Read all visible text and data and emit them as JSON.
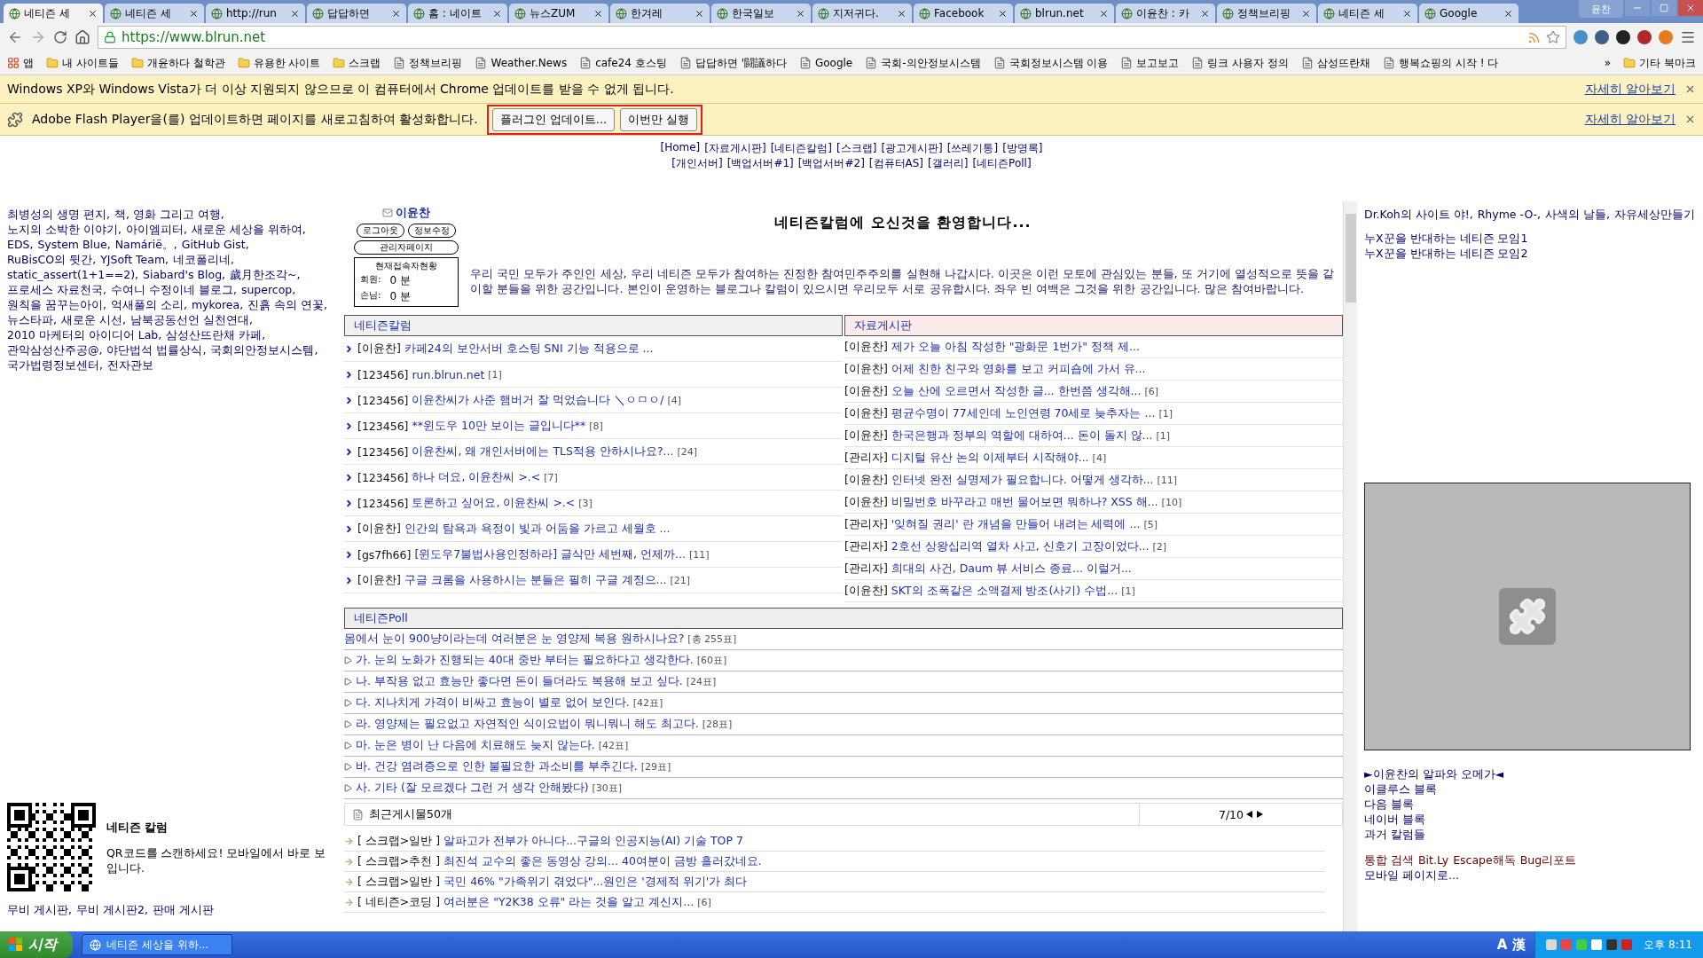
{
  "browser": {
    "tabs": [
      {
        "title": "네티즌 세",
        "selected": true
      },
      {
        "title": "네티즌 세",
        "selected": false
      },
      {
        "title": "http://run",
        "selected": false
      },
      {
        "title": "답답하면",
        "selected": false
      },
      {
        "title": "홈 : 네이트",
        "selected": false
      },
      {
        "title": "뉴스ZUM",
        "selected": false
      },
      {
        "title": "한겨레",
        "selected": false
      },
      {
        "title": "한국일보",
        "selected": false
      },
      {
        "title": "지저귀다.",
        "selected": false
      },
      {
        "title": "Facebook",
        "selected": false
      },
      {
        "title": "blrun.net",
        "selected": false
      },
      {
        "title": "이윤찬 : 카",
        "selected": false
      },
      {
        "title": "정책브리핑",
        "selected": false
      },
      {
        "title": "네티즌 세",
        "selected": false
      },
      {
        "title": "Google",
        "selected": false
      }
    ],
    "profile": "윤찬",
    "url": "https://www.blrun.net",
    "bookmarks": [
      {
        "label": "앱",
        "kind": "apps"
      },
      {
        "label": "내 사이트들",
        "kind": "folder"
      },
      {
        "label": "개윤하다 철학관",
        "kind": "folder"
      },
      {
        "label": "유용한 사이트",
        "kind": "folder"
      },
      {
        "label": "스크랩",
        "kind": "folder"
      },
      {
        "label": "정책브리핑",
        "kind": "page"
      },
      {
        "label": "Weather.News",
        "kind": "page"
      },
      {
        "label": "cafe24 호스팅",
        "kind": "page"
      },
      {
        "label": "답답하면 '闘議하다",
        "kind": "page"
      },
      {
        "label": "Google",
        "kind": "page"
      },
      {
        "label": "국회-의안정보시스템",
        "kind": "page"
      },
      {
        "label": "국회정보시스템 이용",
        "kind": "page"
      },
      {
        "label": "보고보고",
        "kind": "page"
      },
      {
        "label": "링크 사용자 정의",
        "kind": "page"
      },
      {
        "label": "삼성뜨란채",
        "kind": "page"
      },
      {
        "label": "행복쇼핑의 시작 ! 다",
        "kind": "page"
      }
    ],
    "more": "»",
    "other_bookmarks": "기타 북마크"
  },
  "infobars": [
    {
      "kind": "notice",
      "message": "Windows XP와 Windows Vista가 더 이상 지원되지 않으므로 이 컴퓨터에서 Chrome 업데이트를 받을 수 없게 됩니다.",
      "link": "자세히 알아보기"
    },
    {
      "kind": "plugin",
      "message": "Adobe Flash Player을(를) 업데이트하면 페이지를 새로고침하여 활성화합니다.",
      "buttons": [
        "플러그인 업데이트...",
        "이번만 실행"
      ],
      "highlighted": true,
      "link": "자세히 알아보기"
    }
  ],
  "nav": [
    [
      "[Home]",
      "[자료게시판]",
      "[네티즌칼럼]",
      "[스크랩]",
      "[광고게시판]",
      "[쓰레기통]",
      "[방명록]"
    ],
    [
      "[개인서버]",
      "[백업서버#1]",
      "[백업서버#2]",
      "[컴퓨터AS]",
      "[갤러리]",
      "[네티즌Poll]"
    ]
  ],
  "left_column": {
    "links": [
      "최병성의 생명 편지,",
      "책, 영화 그리고 여행,",
      "노지의 소박한 이야기,",
      "아이엠피터,",
      "새로운 세상을 위하여,",
      "EDS,",
      "System Blue,",
      "Namárië。,",
      "GitHub Gist,",
      "RuBisCO의 뒷간,",
      "YJSoft Team,",
      "네코폴리네,",
      "static_assert(1+1==2),",
      "Siabard's Blog,",
      "歲月한조각~,",
      "프로세스 자료천국,",
      "수여니 수정이네 블로그,",
      "supercop,",
      "원칙을 꿈꾸는아이,",
      "억새풀의 소리,",
      "mykorea,",
      "진흙 속의 연꽃,",
      "뉴스타파,",
      "새로운 시선,",
      "남북공동선언 실천연대,",
      "2010 마케터의 아이디어 Lab,",
      "삼성산뜨란채 카페,",
      "관악삼성산주공@,",
      "야단법석 법률상식,",
      "국회의안정보시스템,",
      "국가법령정보센터,",
      "전자관보"
    ],
    "qr": {
      "title": "네티즌 칼럼",
      "caption": "QR코드를 스캔하세요! 모바일에서 바로 보입니다."
    },
    "footer_links": [
      "무비 게시판,",
      "무비 게시판2,",
      "판매 게시판"
    ]
  },
  "center": {
    "user": {
      "name": "이윤찬",
      "buttons": [
        "로그아웃",
        "정보수정"
      ],
      "admin": "관리자페이지",
      "stats_title": "현재접속자현황",
      "stats": [
        {
          "label": "회원:",
          "value": "0 분"
        },
        {
          "label": "손님:",
          "value": "0 분"
        }
      ]
    },
    "welcome": {
      "title": "네티즌칼럼에 오신것을 환영합니다...",
      "body": "우리 국민 모두가 주인인 세상, 우리 네티즌 모두가 참여하는 진정한 참여민주주의를 실현해 나갑시다. 이곳은 이런 모토에 관심있는 분들, 또 거기에 열성적으로 뜻을 같이할 분들을 위한 공간입니다. 본인이 운영하는 블로그나 칼럼이 있으시면 우리모두 서로 공유합시다. 좌우 빈 여백은 그것을 위한 공간입니다. 많은 참여바랍니다."
    },
    "boards": [
      {
        "title": "네티즌칼럼",
        "color": "#f0f0f0",
        "kind": "bulleted",
        "rows": [
          {
            "author": "[이윤찬]",
            "title": "카페24의 보안서버 호스팅 SNI 기능 적용으로 ..."
          },
          {
            "author": "[123456]",
            "title": "run.blrun.net",
            "count": "[1]"
          },
          {
            "author": "[123456]",
            "title": "이윤찬씨가 사준 햄버거 잘 먹었습니다 ＼ㅇㅁㅇ/",
            "count": "[4]"
          },
          {
            "author": "[123456]",
            "title": "**윈도우 10만 보이는 글입니다**",
            "count": "[8]"
          },
          {
            "author": "[123456]",
            "title": "이윤찬씨, 왜 개인서버에는 TLS적용 안하시나요?...",
            "count": "[24]"
          },
          {
            "author": "[123456]",
            "title": "하나 더요, 이윤찬씨 >.<",
            "count": "[7]"
          },
          {
            "author": "[123456]",
            "title": "토론하고 싶어요, 이윤찬씨 >.<",
            "count": "[3]"
          },
          {
            "author": "[이윤찬]",
            "title": "인간의 탐욕과 욕정이 빛과 어둠을 가르고 세월호 ..."
          },
          {
            "author": "[gs7fh66]",
            "title": "[윈도우7불법사용인정하라] 글삭만 세번째, 언제까...",
            "count": "[11]"
          },
          {
            "author": "[이윤찬]",
            "title": "구글 크롬을 사용하시는 분들은 필히 구글 계정으...",
            "count": "[21]"
          }
        ]
      },
      {
        "title": "자료게시판",
        "color": "#fbeaea",
        "kind": "plain",
        "rows": [
          {
            "author": "[이윤찬]",
            "title": "제가 오늘 아침 작성한 \"광화문 1번가\" 정책 제..."
          },
          {
            "author": "[이윤찬]",
            "title": "어제 친한 친구와 영화를 보고 커피숍에 가서 유..."
          },
          {
            "author": "[이윤찬]",
            "title": "오늘 산에 오르면서 작성한 글... 한번쯤 생각해...",
            "count": "[6]"
          },
          {
            "author": "[이윤찬]",
            "title": "평균수명이 77세인데 노인연령 70세로 늦추자는 ...",
            "count": "[1]"
          },
          {
            "author": "[이윤찬]",
            "title": "한국은행과 정부의 역할에 대하여... 돈이 돌지 않...",
            "count": "[1]"
          },
          {
            "author": "[관리자]",
            "title": "디지털 유산 논의 이제부터 시작해야...",
            "count": "[4]"
          },
          {
            "author": "[이윤찬]",
            "title": "인터넷 완전 실명제가 필요합니다. 어떻게 생각하...",
            "count": "[11]"
          },
          {
            "author": "[이윤찬]",
            "title": "비밀번호 바꾸라고 매번 물어보면 뭐하나? XSS 해...",
            "count": "[10]"
          },
          {
            "author": "[관리자]",
            "title": "'잊혀질 권리' 란 개념을 만들어 내려는 세력에 ...",
            "count": "[5]"
          },
          {
            "author": "[관리자]",
            "title": "2호선 상왕십리역 열차 사고, 신호기 고장이었다...",
            "count": "[2]"
          },
          {
            "author": "[관리자]",
            "title": "희대의 사건, Daum 뷰 서비스 종료... 이럴거..."
          },
          {
            "author": "[이윤찬]",
            "title": "SKT의 조폭같은 소액결제 방조(사기) 수법...",
            "count": "[1]"
          }
        ]
      }
    ],
    "poll": {
      "title": "네티즌Poll",
      "question": "몸에서 눈이 900냥이라는데 여러분은 눈 영양제 복용 원하시나요?",
      "total": "[총 255표]",
      "options": [
        {
          "text": "가. 눈의 노화가 진행되는 40대 중반 부터는 필요하다고 생각한다.",
          "votes": "[60표]"
        },
        {
          "text": "나. 부작용 없고 효능만 좋다면 돈이 들더라도 복용해 보고 싶다.",
          "votes": "[24표]"
        },
        {
          "text": "다. 지나치게 가격이 비싸고 효능이 별로 없어 보인다.",
          "votes": "[42표]"
        },
        {
          "text": "라. 영양제는 필요없고 자연적인 식이요법이 뭐니뭐니 해도 최고다.",
          "votes": "[28표]"
        },
        {
          "text": "마. 눈은 병이 난 다음에 치료해도 늦지 않는다.",
          "votes": "[42표]"
        },
        {
          "text": "바. 건강 염려증으로 인한 불필요한 과소비를 부추긴다.",
          "votes": "[29표]"
        },
        {
          "text": "사. 기타 (잘 모르겠다 그런 거 생각 안해봤다)",
          "votes": "[30표]"
        }
      ]
    },
    "recent": {
      "title": "최근게시물50개",
      "page": "7/10",
      "rows": [
        {
          "category": "[ 스크랩>일반 ]",
          "title": "알파고가 전부가 아니다...구글의 인공지능(AI) 기술 TOP 7"
        },
        {
          "category": "[ 스크랩>추천 ]",
          "title": "최진석 교수의 좋은 동영상 강의... 40여분이 금방 흘러갔네요."
        },
        {
          "category": "[ 스크랩>일반 ]",
          "title": "국민 46% \"가족위기 겪었다\"...원인은 '경제적 위기'가 최다"
        },
        {
          "category": "[ 네티즌>코딩 ]",
          "title": "여러분은 \"Y2K38 오류\" 라는 것을 알고 계신지...",
          "count": "[6]"
        }
      ]
    }
  },
  "right_column": {
    "links": [
      "Dr.Koh의 사이트 야!,",
      "Rhyme -O-,",
      "사색의 날들,",
      "자유세상만들기"
    ],
    "groups": [
      "누X꾼을 반대하는 네티즌 모임1",
      "누X꾼을 반대하는 네티즌 모임2"
    ],
    "blogs": [
      "►이윤찬의 알파와 오메가◄",
      "이클루스 블록",
      "다음 블록",
      "네이버 블록",
      "과거 칼럼들"
    ],
    "tools": [
      "통합 검색",
      "Bit.Ly",
      "Escape해독",
      "Bug리포트"
    ],
    "mobile": "모바일 페이지로..."
  },
  "taskbar": {
    "start": "시작",
    "windows": [
      "네티즌 세상을 위하..."
    ],
    "ime": [
      "A",
      "漢"
    ],
    "clock": "오후 8:11"
  }
}
